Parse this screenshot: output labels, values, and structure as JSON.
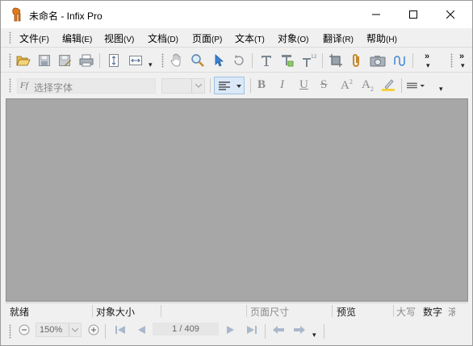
{
  "window": {
    "title": "未命名 - Infix Pro",
    "controls": {
      "minimize": "minimize-icon",
      "maximize": "maximize-icon",
      "close": "close-icon"
    }
  },
  "menu": [
    {
      "label": "文件",
      "acc": "(F)"
    },
    {
      "label": "编辑",
      "acc": "(E)"
    },
    {
      "label": "视图",
      "acc": "(V)"
    },
    {
      "label": "文档",
      "acc": "(D)"
    },
    {
      "label": "页面",
      "acc": "(P)"
    },
    {
      "label": "文本",
      "acc": "(T)"
    },
    {
      "label": "对象",
      "acc": "(O)"
    },
    {
      "label": "翻译",
      "acc": "(R)"
    },
    {
      "label": "帮助",
      "acc": "(H)"
    }
  ],
  "format_toolbar": {
    "font_icon_text": "Ff",
    "font_placeholder": "选择字体",
    "font_size_value": "",
    "bold": "B",
    "italic": "I",
    "underline": "U",
    "strikethrough": "S",
    "superscript": "A",
    "superscript_mark": "2",
    "subscript": "A",
    "subscript_mark": "2"
  },
  "status_bar": {
    "status": "就绪",
    "object_size": "对象大小",
    "page_size": "页面尺寸",
    "preview": "预览",
    "caps": "大写",
    "num": "数字",
    "scroll": "滚"
  },
  "nav_toolbar": {
    "zoom_value": "150%",
    "page_indicator": "1 / 409"
  },
  "colors": {
    "canvas": "#a7a7a7",
    "chrome": "#f0f0f0",
    "accent_blue": "#1e73c8"
  }
}
